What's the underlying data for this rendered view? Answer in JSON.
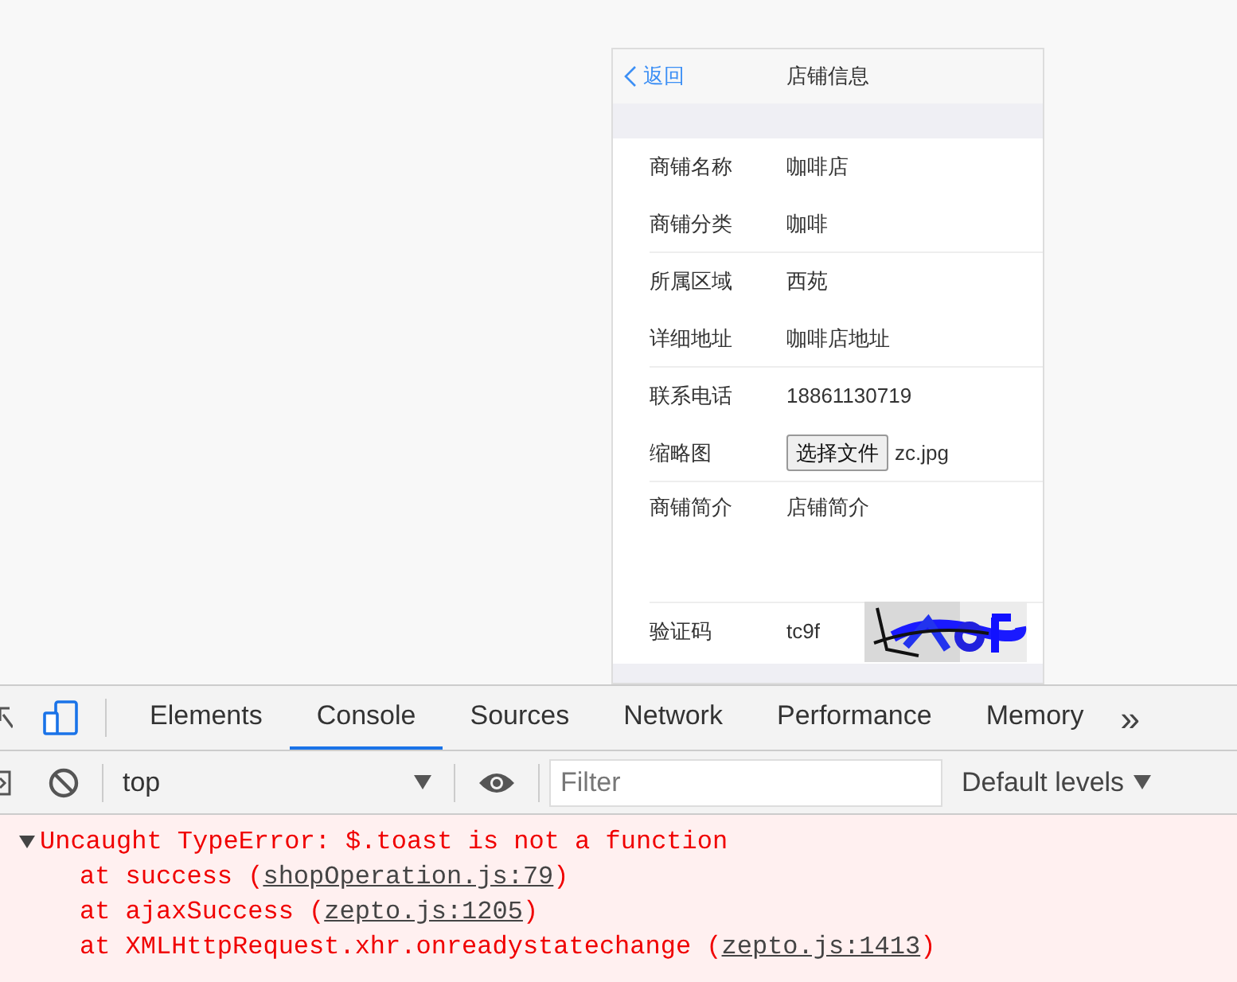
{
  "phone": {
    "back": "返回",
    "title": "店铺信息",
    "fields": [
      {
        "kind": "text",
        "label": "商铺名称",
        "value": "咖啡店",
        "divider": false
      },
      {
        "kind": "text",
        "label": "商铺分类",
        "value": "咖啡",
        "divider": true
      },
      {
        "kind": "text",
        "label": "所属区域",
        "value": "西苑",
        "divider": false
      },
      {
        "kind": "text",
        "label": "详细地址",
        "value": "咖啡店地址",
        "divider": true
      },
      {
        "kind": "text",
        "label": "联系电话",
        "value": "18861130719",
        "divider": false
      },
      {
        "kind": "file",
        "label": "缩略图",
        "button": "选择文件",
        "value": "zc.jpg",
        "divider": true
      },
      {
        "kind": "textarea",
        "label": "商铺简介",
        "value": "店铺简介",
        "divider": true
      },
      {
        "kind": "captcha",
        "label": "验证码",
        "value": "tc9f",
        "divider": false
      }
    ]
  },
  "devtools": {
    "tabs": [
      {
        "label": "Elements",
        "selected": false
      },
      {
        "label": "Console",
        "selected": true
      },
      {
        "label": "Sources",
        "selected": false
      },
      {
        "label": "Network",
        "selected": false
      },
      {
        "label": "Performance",
        "selected": false
      },
      {
        "label": "Memory",
        "selected": false
      }
    ],
    "more": "»",
    "context": "top",
    "filter": {
      "placeholder": "Filter"
    },
    "levels": "Default levels",
    "error": {
      "message": "Uncaught TypeError: $.toast is not a function",
      "stack": [
        {
          "prefix": "at success (",
          "link": "shopOperation.js:79",
          "suffix": ")"
        },
        {
          "prefix": "at ajaxSuccess (",
          "link": "zepto.js:1205",
          "suffix": ")"
        },
        {
          "prefix": "at XMLHttpRequest.xhr.onreadystatechange (",
          "link": "zepto.js:1413",
          "suffix": ")"
        }
      ]
    }
  }
}
